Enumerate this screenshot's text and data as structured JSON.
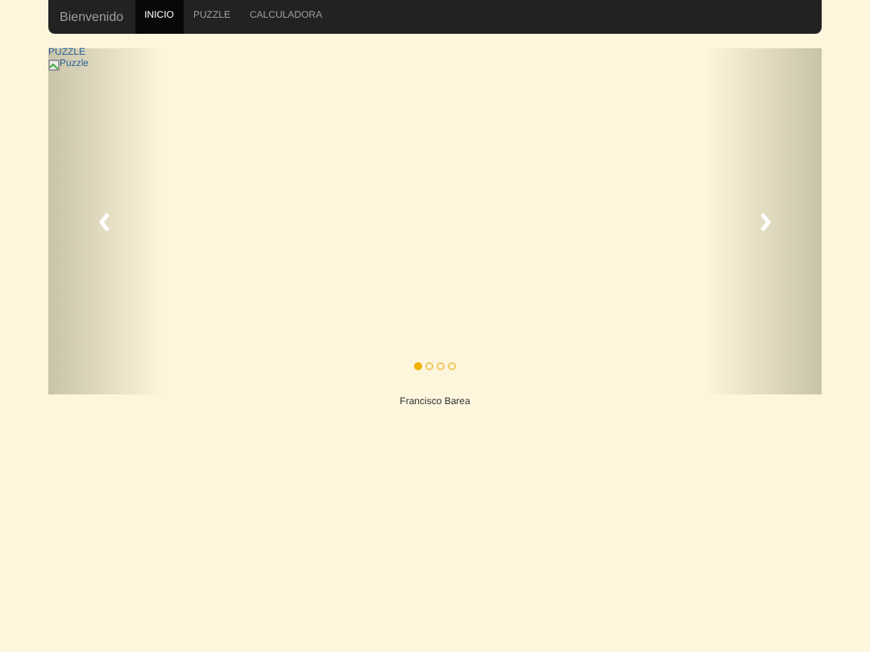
{
  "navbar": {
    "brand": "Bienvenido",
    "items": [
      {
        "label": "INICIO",
        "selected": true
      },
      {
        "label": "PUZZLE",
        "selected": false
      },
      {
        "label": "CALCULADORA",
        "selected": false
      }
    ]
  },
  "carousel": {
    "slide_title": "PUZZLE",
    "image_alt": "Puzzle",
    "indicators": [
      {
        "selected": true
      },
      {
        "selected": false
      },
      {
        "selected": false
      },
      {
        "selected": false
      }
    ]
  },
  "footer": {
    "text": "Francisco Barea"
  }
}
